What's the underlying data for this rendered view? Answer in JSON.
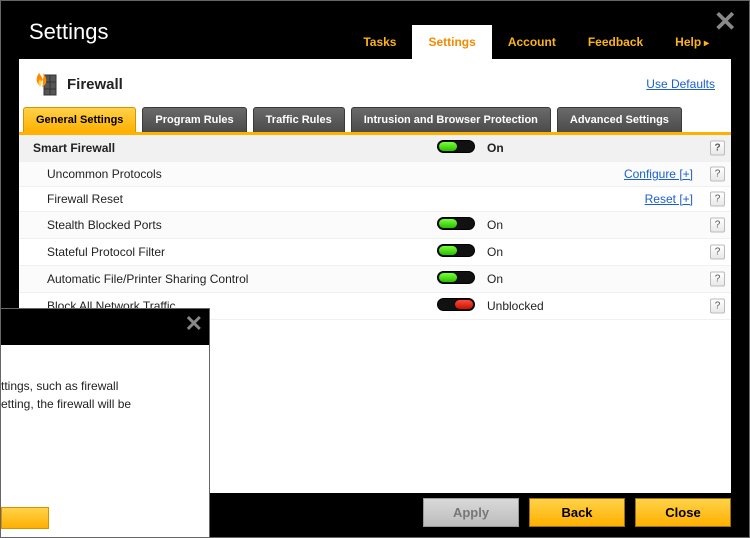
{
  "window": {
    "title": "Settings"
  },
  "topnav": {
    "tasks": "Tasks",
    "settings": "Settings",
    "account": "Account",
    "feedback": "Feedback",
    "help": "Help"
  },
  "section": {
    "title": "Firewall",
    "use_defaults": "Use Defaults"
  },
  "tabs": {
    "general": "General Settings",
    "program": "Program Rules",
    "traffic": "Traffic Rules",
    "intrusion": "Intrusion and Browser Protection",
    "advanced": "Advanced Settings"
  },
  "rows": {
    "smart_firewall": {
      "label": "Smart Firewall",
      "status": "On"
    },
    "uncommon_protocols": {
      "label": "Uncommon Protocols",
      "action": "Configure [+]"
    },
    "firewall_reset": {
      "label": "Firewall Reset",
      "action": "Reset [+]"
    },
    "stealth_ports": {
      "label": "Stealth Blocked Ports",
      "status": "On"
    },
    "stateful_filter": {
      "label": "Stateful Protocol Filter",
      "status": "On"
    },
    "auto_share": {
      "label": "Automatic File/Printer Sharing Control",
      "status": "On"
    },
    "block_all": {
      "label": "Block All Network Traffic",
      "status": "Unblocked"
    }
  },
  "buttons": {
    "apply": "Apply",
    "back": "Back",
    "close": "Close"
  },
  "overlay": {
    "line1": "ttings, such as firewall",
    "line2": "etting, the firewall will be"
  },
  "help_glyph": "?",
  "close_glyph": "✕"
}
